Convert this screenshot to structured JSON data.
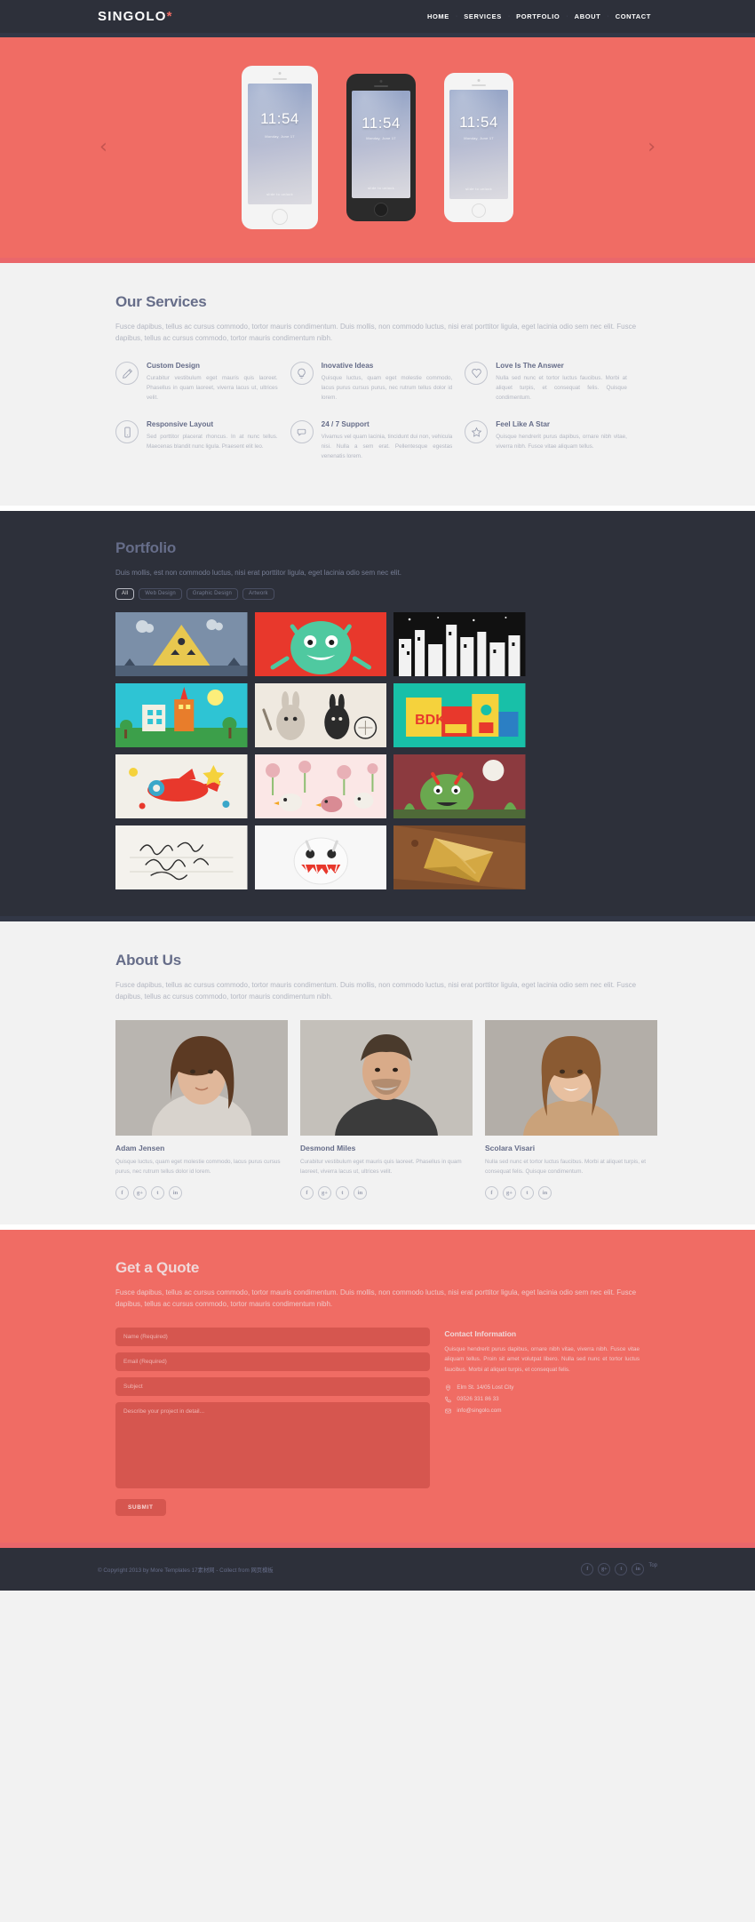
{
  "header": {
    "logo": "SINGOLO",
    "logo_dot": "*",
    "nav": [
      {
        "label": "HOME"
      },
      {
        "label": "SERVICES"
      },
      {
        "label": "PORTFOLIO"
      },
      {
        "label": "ABOUT"
      },
      {
        "label": "CONTACT"
      }
    ]
  },
  "hero": {
    "prev_icon": "chevron-left-icon",
    "next_icon": "chevron-right-icon",
    "prev_glyph": "‹",
    "next_glyph": "›",
    "phones": [
      {
        "time": "11:54",
        "date": "Monday, June 17",
        "unlock": "slide to unlock",
        "style": "white"
      },
      {
        "time": "11:54",
        "date": "Monday, June 17",
        "unlock": "slide to unlock",
        "style": "black"
      },
      {
        "time": "11:54",
        "date": "Monday, June 17",
        "unlock": "slide to unlock",
        "style": "white"
      }
    ]
  },
  "services": {
    "title": "Our Services",
    "description": "Fusce dapibus, tellus ac cursus commodo, tortor mauris condimentum. Duis mollis, non commodo luctus, nisi erat porttitor ligula, eget lacinia odio sem nec elit. Fusce dapibus, tellus ac cursus commodo, tortor mauris condimentum nibh.",
    "items": [
      {
        "icon": "pencil-icon",
        "title": "Custom Design",
        "text": "Curabitur vestibulum eget mauris quis laoreet. Phasellus in quam laoreet, viverra lacus ut, ultrices velit."
      },
      {
        "icon": "lightbulb-icon",
        "title": "Inovative Ideas",
        "text": "Quisque luctus, quam eget molestie commodo, lacus purus cursus purus, nec rutrum tellus dolor id lorem."
      },
      {
        "icon": "heart-icon",
        "title": "Love Is The Answer",
        "text": "Nulla sed nunc et tortor luctus faucibus. Morbi at aliquet turpis, et consequat felis. Quisque condimentum."
      },
      {
        "icon": "phone-icon",
        "title": "Responsive Layout",
        "text": "Sed porttitor placerat rhoncus. In at nunc tellus. Maecenas blandit nunc ligula. Praesent elit leo."
      },
      {
        "icon": "chat-icon",
        "title": "24 / 7 Support",
        "text": "Vivamus vel quam lacinia, tincidunt dui non, vehicula nisi. Nulla a sem erat. Pellentesque egestas venenatis lorem."
      },
      {
        "icon": "star-icon",
        "title": "Feel Like A Star",
        "text": "Quisque hendrerit purus dapibus, ornare nibh vitae, viverra nibh. Fusce vitae aliquam tellus."
      }
    ]
  },
  "portfolio": {
    "title": "Portfolio",
    "description": "Duis mollis, est non commodo luctus, nisi erat porttitor ligula, eget lacinia odio sem nec elit.",
    "filters": [
      {
        "label": "All",
        "active": true
      },
      {
        "label": "Web Design",
        "active": false
      },
      {
        "label": "Graphic Design",
        "active": false
      },
      {
        "label": "Artwork",
        "active": false
      }
    ],
    "items": [
      {
        "name": "triangle-pyramid-artwork"
      },
      {
        "name": "green-monster-artwork"
      },
      {
        "name": "black-white-city-artwork"
      },
      {
        "name": "robot-city-artwork"
      },
      {
        "name": "rabbit-tennis-artwork"
      },
      {
        "name": "bdk-blocks-artwork"
      },
      {
        "name": "red-plane-artwork"
      },
      {
        "name": "birds-flowers-artwork"
      },
      {
        "name": "green-beast-artwork"
      },
      {
        "name": "handwriting-artwork"
      },
      {
        "name": "white-monster-artwork"
      },
      {
        "name": "gold-wrap-artwork"
      }
    ]
  },
  "about": {
    "title": "About Us",
    "description": "Fusce dapibus, tellus ac cursus commodo, tortor mauris condimentum. Duis mollis, non commodo luctus, nisi erat porttitor ligula, eget lacinia odio sem nec elit. Fusce dapibus, tellus ac cursus commodo, tortor mauris condimentum nibh.",
    "members": [
      {
        "name": "Adam Jensen",
        "bio": "Quisque luctus, quam eget molestie commodo, lacus purus cursus purus, nec rutrum tellus dolor id lorem.",
        "socials": [
          "f",
          "g+",
          "t",
          "in"
        ]
      },
      {
        "name": "Desmond Miles",
        "bio": "Curabitur vestibulum eget mauris quis laoreet. Phasellus in quam laoreet, viverra lacus ut, ultrices velit.",
        "socials": [
          "f",
          "g+",
          "t",
          "in"
        ]
      },
      {
        "name": "Scolara Visari",
        "bio": "Nulla sed nunc et tortor luctus faucibus. Morbi at aliquet turpis, et consequat felis. Quisque condimentum.",
        "socials": [
          "f",
          "g+",
          "t",
          "in"
        ]
      }
    ]
  },
  "quote": {
    "title": "Get a Quote",
    "description": "Fusce dapibus, tellus ac cursus commodo, tortor mauris condimentum. Duis mollis, non commodo luctus, nisi erat porttitor ligula, eget lacinia odio sem nec elit. Fusce dapibus, tellus ac cursus commodo, tortor mauris condimentum nibh.",
    "form": {
      "name_placeholder": "Name (Required)",
      "name_value": "",
      "email_placeholder": "Email (Required)",
      "email_value": "",
      "subject_placeholder": "Subject",
      "subject_value": "",
      "message_placeholder": "Describe your project in detail...",
      "message_value": "",
      "submit_label": "SUBMIT"
    },
    "contact": {
      "title": "Contact Information",
      "text": "Quisque hendrerit purus dapibus, ornare nibh vitae, viverra nibh. Fusce vitae aliquam tellus. Proin sit amet volutpat libero. Nulla sed nunc et tortor luctus faucibus. Morbi at aliquet turpis, et consequat felis.",
      "address_icon": "location-pin-icon",
      "address": "Elm St. 14/05 Lost City",
      "phone_icon": "phone-handset-icon",
      "phone": "03526 331 86 33",
      "email_icon": "envelope-icon",
      "email": "info@singolo.com"
    }
  },
  "footer": {
    "copyright": "© Copyright 2013 by More Templates 17素材网 - Collect from 网页模板",
    "socials": [
      "f",
      "g+",
      "t",
      "in"
    ],
    "top_label": "Top"
  },
  "colors": {
    "accent": "#f06c64",
    "dark": "#2d303a",
    "muted": "#666d89",
    "light": "#f2f2f2"
  }
}
